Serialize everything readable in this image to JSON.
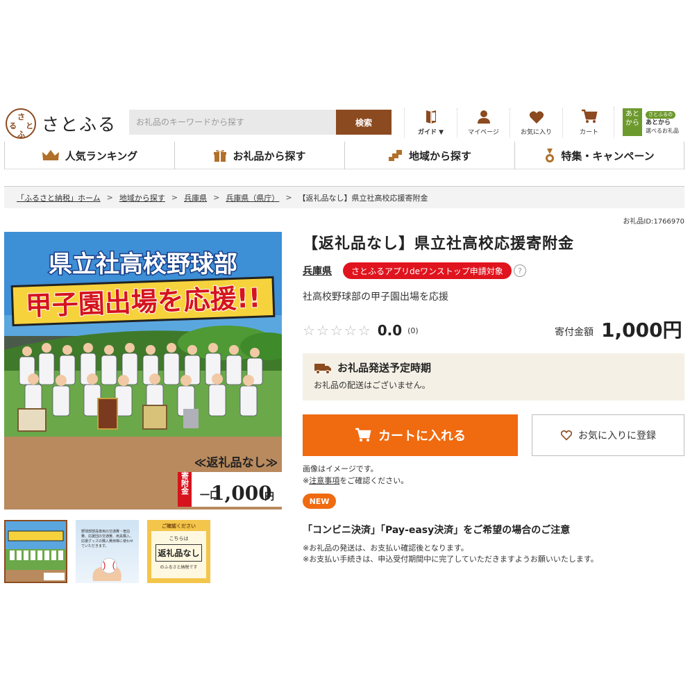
{
  "header": {
    "logo_text": "さとふる",
    "logo_mark_chars": [
      "さ",
      "と",
      "ふ",
      "る"
    ],
    "search": {
      "placeholder": "お礼品のキーワードから探す",
      "button_label": "検索"
    },
    "nav": [
      {
        "label": "ガイド ▼",
        "icon": "guide-book-icon"
      },
      {
        "label": "マイページ",
        "icon": "person-icon"
      },
      {
        "label": "お気に入り",
        "icon": "heart-icon"
      },
      {
        "label": "カート",
        "icon": "cart-icon"
      }
    ],
    "atokara": {
      "box_top": "あと",
      "box_bottom": "から",
      "pill": "さとふるの",
      "line1": "あとから",
      "line2": "選べるお礼品"
    }
  },
  "categories": [
    {
      "label": "人気ランキング",
      "icon": "crown-icon"
    },
    {
      "label": "お礼品から探す",
      "icon": "gift-icon"
    },
    {
      "label": "地域から探す",
      "icon": "map-icon"
    },
    {
      "label": "特集・キャンペーン",
      "icon": "medal-icon"
    }
  ],
  "breadcrumb": [
    "「ふるさと納税」ホーム",
    "地域から探す",
    "兵庫県",
    "兵庫県（県庁）",
    "【返礼品なし】県立社高校応援寄附金"
  ],
  "item_id": "お礼品ID:1766970",
  "product": {
    "title": "【返礼品なし】県立社高校応援寄附金",
    "prefecture": "兵庫県",
    "app_badge": "さとふるアプリdeワンストップ申請対象",
    "help_mark": "?",
    "description": "社高校野球部の甲子園出場を応援",
    "rating": "0.0",
    "rating_value": 0,
    "rating_max": 5,
    "review_count": "(0)",
    "price_label": "寄付金額",
    "price": "1,000円"
  },
  "image": {
    "line1": "県立社高校野球部",
    "line2": "甲子園出場を応援!!",
    "no_gift": "≪返礼品なし≫",
    "kifukin": "寄附金",
    "ichiguchi": "一口",
    "amount": "1,000",
    "yen": "円",
    "uniform": "YASHIRO"
  },
  "thumbs": {
    "t2_text": "野球部部員専用の交通費・宿泊費、応援団の交通費、用具購入、応援グッズの購入費用等に使わせていただきます。",
    "t3_header": "ご確認ください",
    "t3_line1": "こちらは",
    "t3_line2": "返礼品なし",
    "t3_line3": "のふるさと納税です"
  },
  "shipping": {
    "title": "お礼品発送予定時期",
    "text": "お礼品の配送はございません。"
  },
  "buttons": {
    "cart": "カートに入れる",
    "favorite": "お気に入りに登録"
  },
  "notes": {
    "image_note": "画像はイメージです。",
    "caution_prefix": "※",
    "caution_link": "注意事項",
    "caution_suffix": "をご確認ください。",
    "new_badge": "NEW"
  },
  "convenience": {
    "title": "「コンビニ決済」「Pay-easy決済」をご希望の場合のご注意",
    "line1": "※お礼品の発送は、お支払い確認後となります。",
    "line2": "※お支払い手続きは、申込受付期間中に完了していただきますようお願いいたします。"
  },
  "colors": {
    "brand_brown": "#8b4a1f",
    "cart_orange": "#f06a0f",
    "badge_red": "#e0141e",
    "ship_bg": "#f5f0e6",
    "atokara_green": "#6d9a2c"
  }
}
